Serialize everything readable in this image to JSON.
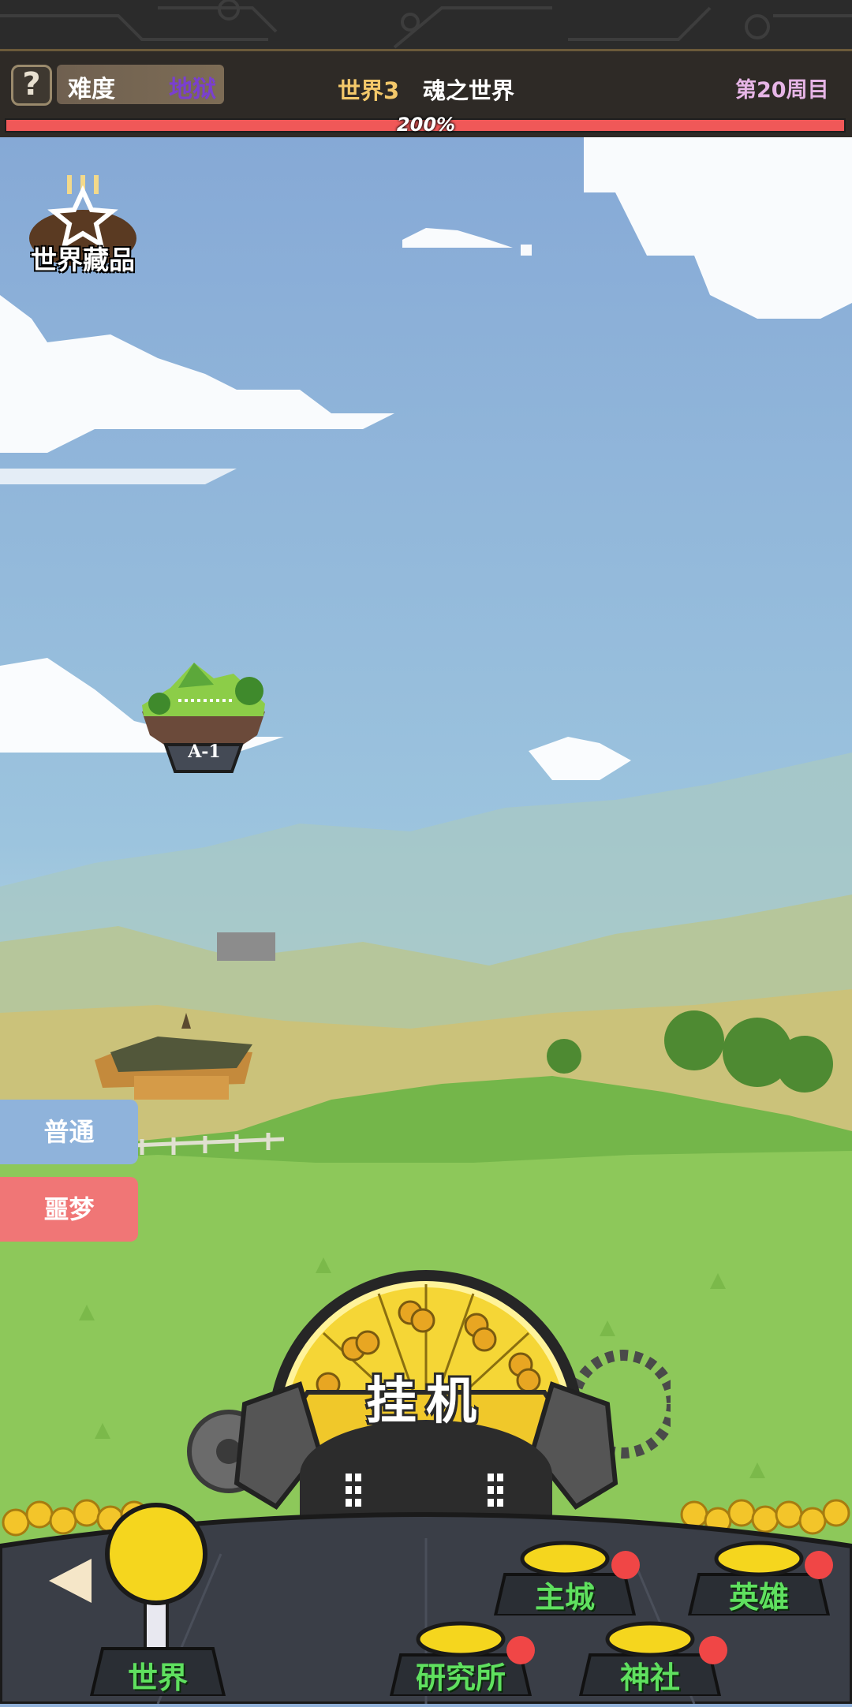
{
  "header": {
    "help_glyph": "?",
    "difficulty_label": "难度",
    "difficulty_value": "地狱",
    "world_number": "世界3",
    "world_name": "魂之世界",
    "cycle": "第20周目",
    "progress_text": "200%",
    "progress_fraction": 1.0
  },
  "collection": {
    "label": "世界藏品",
    "icon": "medal-star-icon"
  },
  "stage": {
    "tag": "A-1"
  },
  "modes": {
    "normal": "普通",
    "nightmare": "噩梦"
  },
  "idle": {
    "label": "挂机"
  },
  "nav": {
    "back_icon": "back-arrow-icon",
    "world": "世界",
    "main_city": "主城",
    "heroes": "英雄",
    "research": "研究所",
    "shrine": "神社"
  },
  "colors": {
    "sky": "#8fb0d8",
    "grass": "#8dc85a",
    "progress": "#f05858",
    "nav_text": "#5fe05f",
    "notification": "#f04646",
    "nightmare_button": "#f07676",
    "normal_button": "#8fb3db"
  }
}
